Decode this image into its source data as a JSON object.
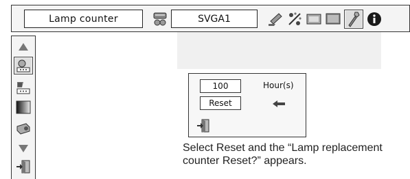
{
  "menu": {
    "title": "Lamp counter",
    "input_source": "SVGA1",
    "icons": [
      "input-select-icon",
      "pc-adjust-icon",
      "image-select-icon",
      "image-adjust-icon",
      "screen-icon",
      "setting-icon",
      "information-icon"
    ]
  },
  "sidebar": {
    "icons": [
      "scroll-up-icon",
      "lamp-counter-icon",
      "filter-counter-icon",
      "gradation-icon",
      "projector-icon",
      "scroll-down-icon",
      "exit-icon"
    ]
  },
  "dialog": {
    "hours_value": "100",
    "hours_label": "Hour(s)",
    "reset_label": "Reset"
  },
  "caption": "Select Reset and the “Lamp replacement counter Reset?” appears."
}
